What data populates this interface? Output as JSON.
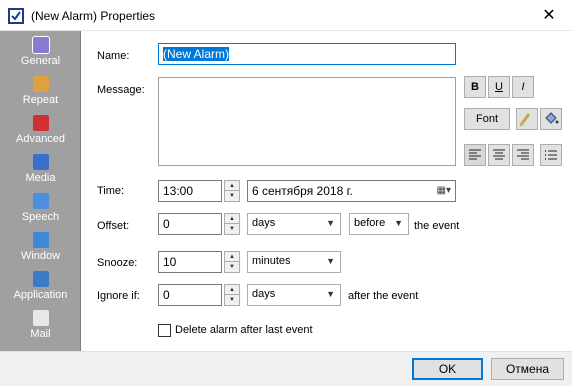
{
  "window": {
    "title": "(New Alarm) Properties"
  },
  "sidebar": {
    "items": [
      {
        "label": "General",
        "icon": "clock-icon",
        "color": "#8a7ad0"
      },
      {
        "label": "Repeat",
        "icon": "calendar-icon",
        "color": "#e0a040"
      },
      {
        "label": "Advanced",
        "icon": "advanced-icon",
        "color": "#d03030"
      },
      {
        "label": "Media",
        "icon": "music-note-icon",
        "color": "#3a6fd0"
      },
      {
        "label": "Speech",
        "icon": "speech-icon",
        "color": "#4a8fe0"
      },
      {
        "label": "Window",
        "icon": "monitor-icon",
        "color": "#3a8ad8"
      },
      {
        "label": "Application",
        "icon": "application-icon",
        "color": "#3a7ac8"
      },
      {
        "label": "Mail",
        "icon": "mail-icon",
        "color": "#e8e8e8"
      }
    ]
  },
  "form": {
    "name_label": "Name:",
    "name_value": "(New Alarm)",
    "message_label": "Message:",
    "format": {
      "bold": "B",
      "underline": "U",
      "italic": "I",
      "font": "Font"
    },
    "time_label": "Time:",
    "time_value": "13:00",
    "date_value": "6 сентября 2018 г.",
    "offset_label": "Offset:",
    "offset_value": "0",
    "offset_unit": "days",
    "offset_when": "before",
    "offset_suffix": "the event",
    "snooze_label": "Snooze:",
    "snooze_value": "10",
    "snooze_unit": "minutes",
    "ignore_label": "Ignore if:",
    "ignore_value": "0",
    "ignore_unit": "days",
    "ignore_suffix": "after the event",
    "delete_label": "Delete alarm after last event",
    "delete_checked": false
  },
  "footer": {
    "ok": "OK",
    "cancel": "Отмена"
  }
}
